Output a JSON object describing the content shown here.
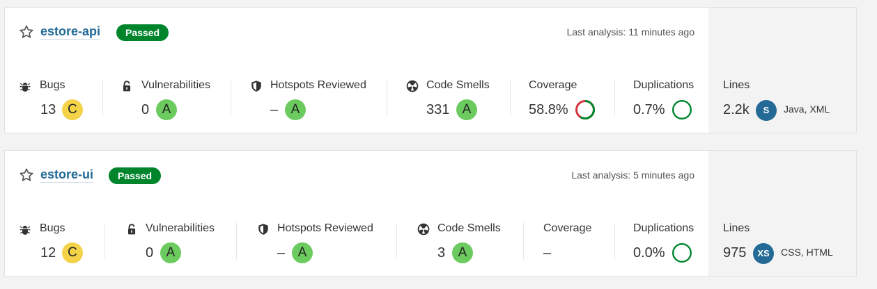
{
  "colors": {
    "accent": "#236a97",
    "passed": "#00852c",
    "rating_a": "#6ccb5f",
    "rating_c": "#f4d348",
    "coverage_covered": "#00852c",
    "coverage_uncovered": "#d4333f"
  },
  "labels": {
    "bugs": "Bugs",
    "vulnerabilities": "Vulnerabilities",
    "hotspots": "Hotspots Reviewed",
    "code_smells": "Code Smells",
    "coverage": "Coverage",
    "duplications": "Duplications",
    "lines": "Lines"
  },
  "projects": [
    {
      "name": "estore-api",
      "status": "Passed",
      "last_analysis": "Last analysis: 11 minutes ago",
      "bugs": {
        "value": "13",
        "rating": "C"
      },
      "vulnerabilities": {
        "value": "0",
        "rating": "A"
      },
      "hotspots": {
        "value": "–",
        "rating": "A"
      },
      "code_smells": {
        "value": "331",
        "rating": "A"
      },
      "coverage": {
        "value": "58.8%",
        "percent": 58.8
      },
      "duplications": {
        "value": "0.7%"
      },
      "lines": {
        "value": "2.2k",
        "size": "S",
        "languages": "Java, XML"
      }
    },
    {
      "name": "estore-ui",
      "status": "Passed",
      "last_analysis": "Last analysis: 5 minutes ago",
      "bugs": {
        "value": "12",
        "rating": "C"
      },
      "vulnerabilities": {
        "value": "0",
        "rating": "A"
      },
      "hotspots": {
        "value": "–",
        "rating": "A"
      },
      "code_smells": {
        "value": "3",
        "rating": "A"
      },
      "coverage": {
        "value": "–"
      },
      "duplications": {
        "value": "0.0%"
      },
      "lines": {
        "value": "975",
        "size": "XS",
        "languages": "CSS, HTML"
      }
    }
  ]
}
